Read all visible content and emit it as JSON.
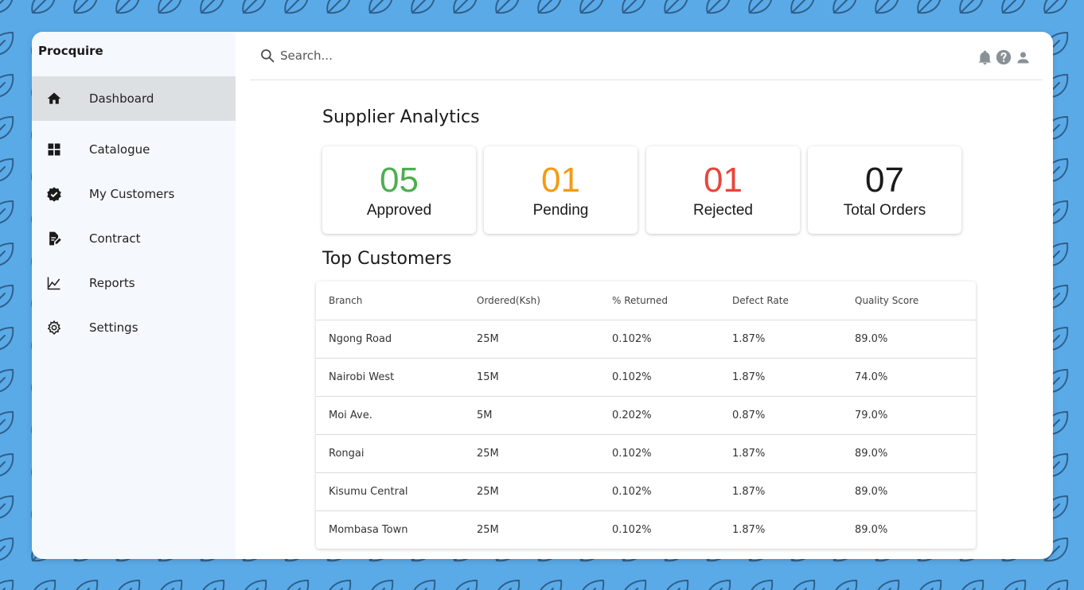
{
  "app": {
    "brand": "Procquire"
  },
  "sidebar": {
    "items": [
      {
        "label": "Dashboard",
        "icon": "home-icon",
        "active": true
      },
      {
        "label": "Catalogue",
        "icon": "grid-icon"
      },
      {
        "label": "My Customers",
        "icon": "verified-badge-icon"
      },
      {
        "label": "Contract",
        "icon": "document-edit-icon"
      },
      {
        "label": "Reports",
        "icon": "line-chart-icon"
      },
      {
        "label": "Settings",
        "icon": "gear-icon"
      }
    ]
  },
  "header": {
    "search_placeholder": "Search...",
    "icons": [
      "bell-icon",
      "help-icon",
      "user-icon"
    ]
  },
  "analytics": {
    "title": "Supplier Analytics",
    "cards": [
      {
        "value": "05",
        "label": "Approved",
        "color": "#4caf50"
      },
      {
        "value": "01",
        "label": "Pending",
        "color": "#f59a12"
      },
      {
        "value": "01",
        "label": "Rejected",
        "color": "#e8453c"
      },
      {
        "value": "07",
        "label": "Total Orders",
        "color": "#1a1a1a"
      }
    ]
  },
  "customers": {
    "title": "Top Customers",
    "columns": [
      "Branch",
      "Ordered(Ksh)",
      "% Returned",
      "Defect Rate",
      "Quality Score"
    ],
    "rows": [
      [
        "Ngong Road",
        "25M",
        "0.102%",
        "1.87%",
        "89.0%"
      ],
      [
        "Nairobi West",
        "15M",
        "0.102%",
        "1.87%",
        "74.0%"
      ],
      [
        "Moi Ave.",
        "5M",
        "0.202%",
        "0.87%",
        "79.0%"
      ],
      [
        "Rongai",
        "25M",
        "0.102%",
        "1.87%",
        "89.0%"
      ],
      [
        "Kisumu Central",
        "25M",
        "0.102%",
        "1.87%",
        "89.0%"
      ],
      [
        "Mombasa Town",
        "25M",
        "0.102%",
        "1.87%",
        "89.0%"
      ]
    ]
  },
  "colors": {
    "background": "#5aaae8",
    "pattern": "#2f5f8a",
    "sidebar": "#f5f9fd",
    "active_nav": "#dde0e2"
  }
}
